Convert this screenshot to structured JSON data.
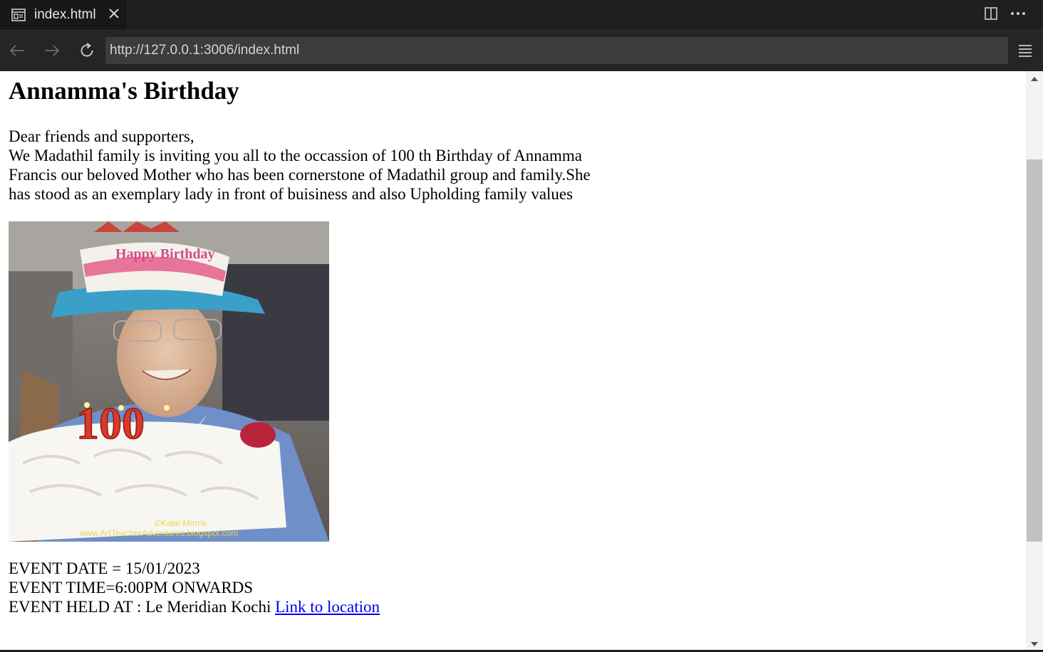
{
  "browser": {
    "tab_title": "index.html",
    "url": "http://127.0.0.1:3006/index.html",
    "icons": {
      "tab": "preview-icon",
      "close": "close-icon",
      "split": "split-editor-icon",
      "more": "more-actions-icon",
      "back": "back-arrow-icon",
      "forward": "forward-arrow-icon",
      "reload": "reload-icon",
      "menu": "menu-icon"
    }
  },
  "page": {
    "title": "Annamma's Birthday",
    "greeting": "Dear friends and supporters,",
    "body": "We Madathil family is inviting you all to the occassion of 100 th Birthday of Annamma Francis our beloved Mother who has been cornerstone of Madathil group and family.She has stood as an exemplary lady in front of buisiness and also Upholding family values",
    "photo": {
      "candles": "100",
      "hat_text": "Happy Birthday",
      "watermark_line1": "©Katie Morris",
      "watermark_line2": "www.ArtTeacherAdventures.blogspot.com"
    },
    "event_date": "EVENT DATE = 15/01/2023",
    "event_time": "EVENT TIME=6:00PM ONWARDS",
    "event_place": "EVENT HELD AT : Le Meridian Kochi ",
    "location_link": "Link to location"
  },
  "colors": {
    "link": "#0000ee",
    "chrome_dark": "#1f1f1f",
    "url_bar": "#3c3c3c",
    "scroll_thumb": "#c1c1c1"
  }
}
